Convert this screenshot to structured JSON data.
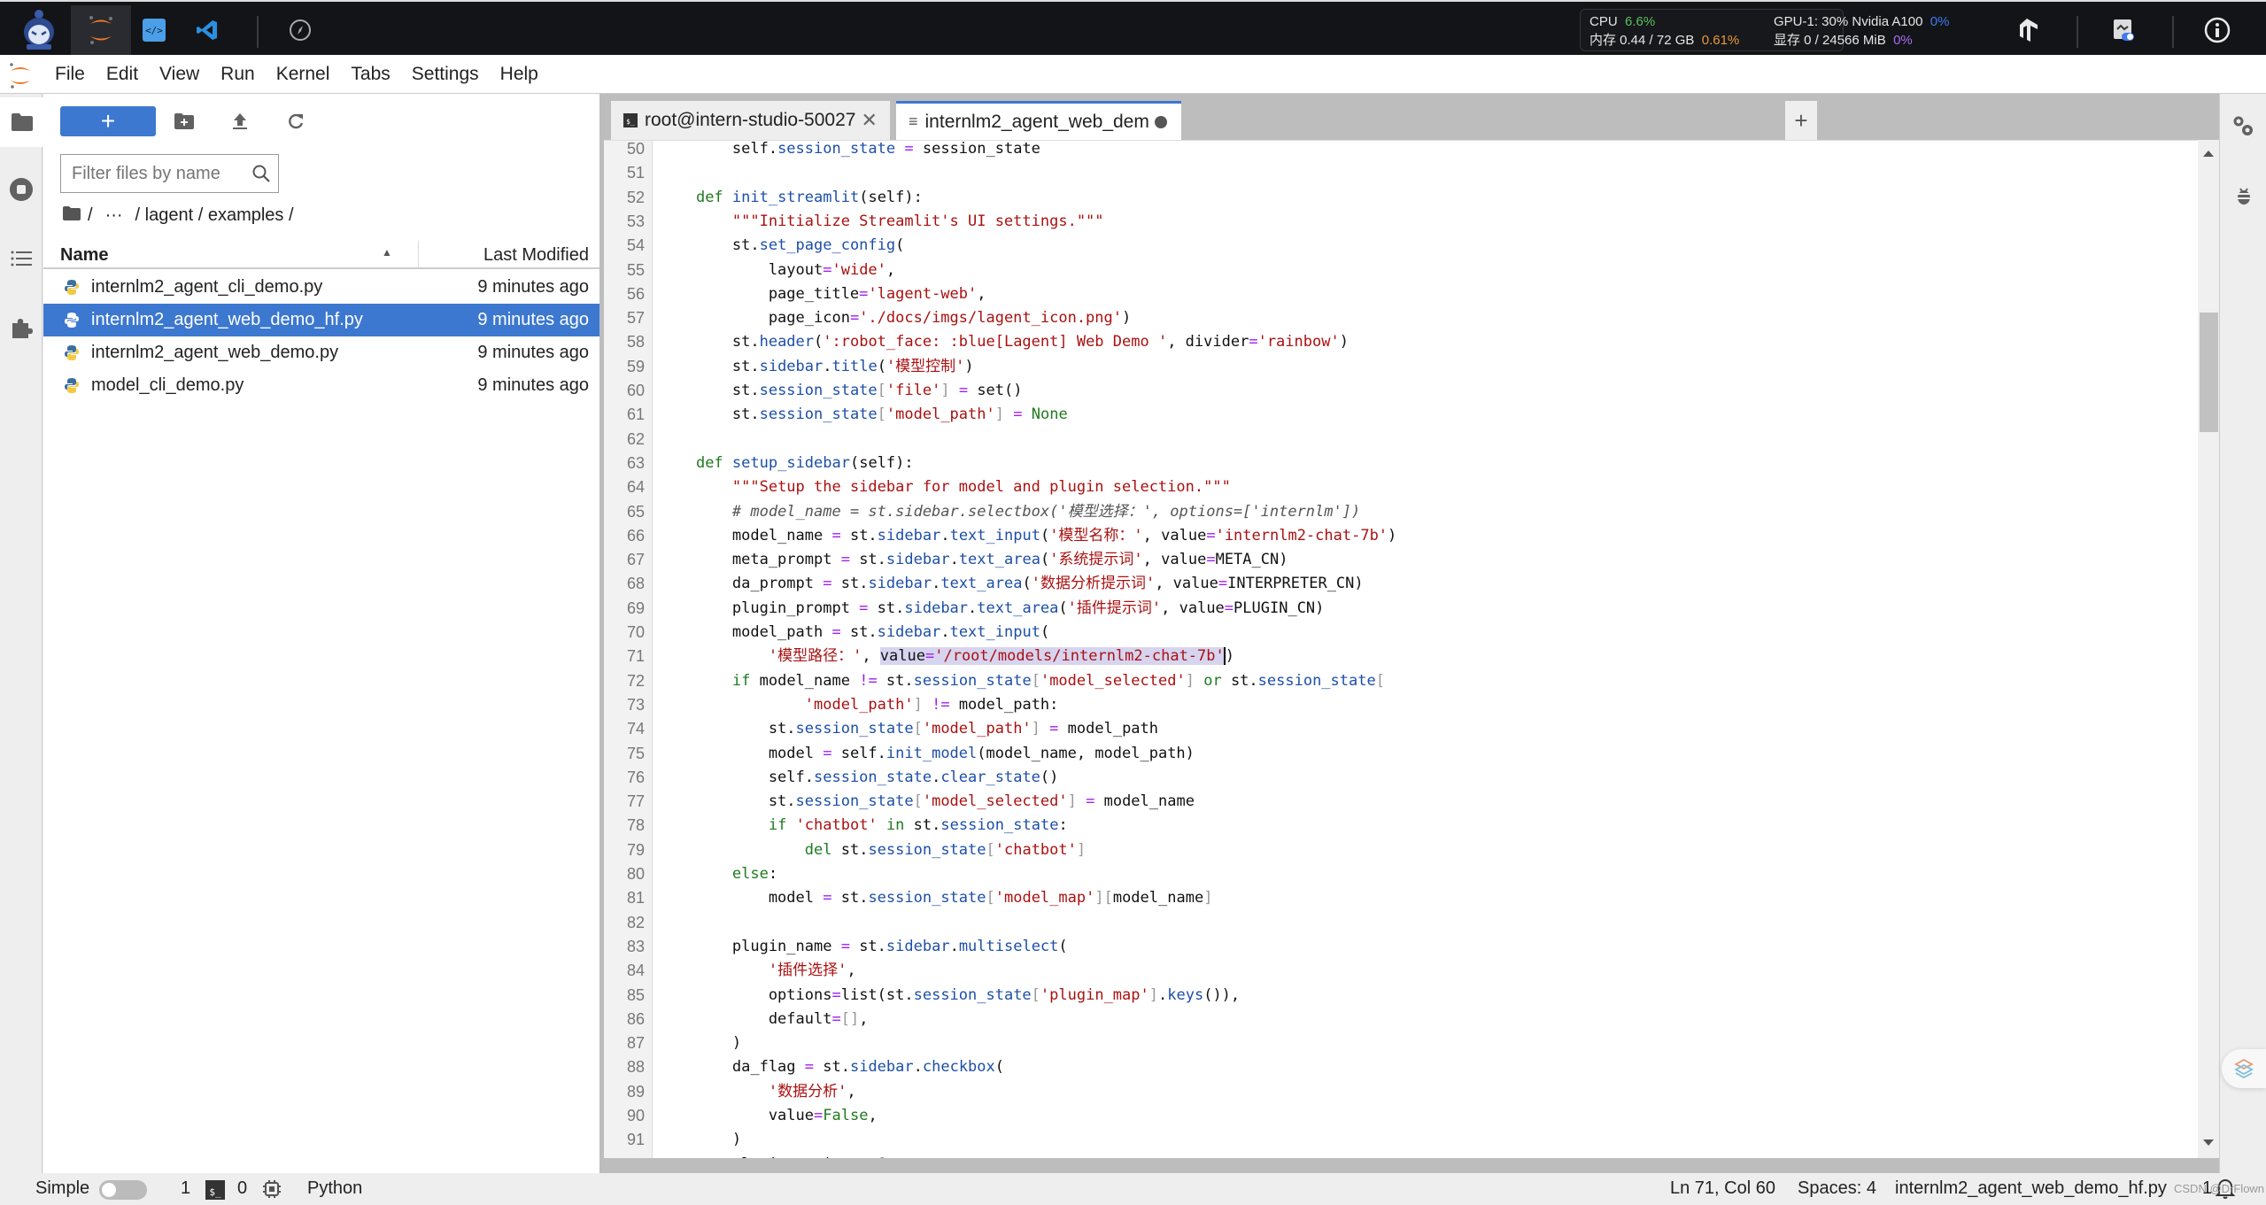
{
  "topbar": {
    "apps": [
      {
        "name": "jupyterlab",
        "active": true
      },
      {
        "name": "code-server",
        "active": false
      },
      {
        "name": "vscode",
        "active": false
      },
      {
        "name": "compass",
        "active": false
      }
    ],
    "stats": {
      "cpu_label": "CPU",
      "cpu_value": "6.6%",
      "gpu_label": "GPU-1: 30% Nvidia A100",
      "gpu_value": "0%",
      "mem_label": "内存 0.44 / 72 GB",
      "mem_value": "0.61%",
      "vram_label": "显存 0 / 24566 MiB",
      "vram_value": "0%"
    },
    "colors": {
      "cpu": "#58c05e",
      "mem": "#e6993d",
      "gpu": "#3d7cf0",
      "vram": "#a76ef2"
    }
  },
  "menu": [
    "File",
    "Edit",
    "View",
    "Run",
    "Kernel",
    "Tabs",
    "Settings",
    "Help"
  ],
  "filebrowser": {
    "new_label": "+",
    "filter_placeholder": "Filter files by name",
    "breadcrumb": [
      "/",
      "···",
      "/ lagent / examples /"
    ],
    "col_name": "Name",
    "col_modified": "Last Modified",
    "files": [
      {
        "name": "internlm2_agent_cli_demo.py",
        "modified": "9 minutes ago",
        "selected": false
      },
      {
        "name": "internlm2_agent_web_demo_hf.py",
        "modified": "9 minutes ago",
        "selected": true
      },
      {
        "name": "internlm2_agent_web_demo.py",
        "modified": "9 minutes ago",
        "selected": false
      },
      {
        "name": "model_cli_demo.py",
        "modified": "9 minutes ago",
        "selected": false
      }
    ]
  },
  "tabs": [
    {
      "label": "root@intern-studio-50027",
      "type": "terminal",
      "active": false
    },
    {
      "label": "internlm2_agent_web_dem",
      "type": "file",
      "active": true,
      "modified": true
    }
  ],
  "editor": {
    "first_line": 50,
    "lines": [
      [
        [
          "",
          "        self."
        ],
        [
          "f",
          "session_state"
        ],
        [
          "",
          " "
        ],
        [
          "o",
          "="
        ],
        [
          "",
          " session_state"
        ]
      ],
      [],
      [
        [
          "",
          "    "
        ],
        [
          "k",
          "def"
        ],
        [
          "",
          " "
        ],
        [
          "f",
          "init_streamlit"
        ],
        [
          "",
          "(self):"
        ]
      ],
      [
        [
          "",
          "        "
        ],
        [
          "s",
          "\"\"\"Initialize Streamlit's UI settings.\"\"\""
        ]
      ],
      [
        [
          "",
          "        st."
        ],
        [
          "f",
          "set_page_config"
        ],
        [
          "",
          "("
        ]
      ],
      [
        [
          "",
          "            layout"
        ],
        [
          "o",
          "="
        ],
        [
          "s",
          "'wide'"
        ],
        [
          "",
          ","
        ]
      ],
      [
        [
          "",
          "            page_title"
        ],
        [
          "o",
          "="
        ],
        [
          "s",
          "'lagent-web'"
        ],
        [
          "",
          ","
        ]
      ],
      [
        [
          "",
          "            page_icon"
        ],
        [
          "o",
          "="
        ],
        [
          "s",
          "'./docs/imgs/lagent_icon.png'"
        ],
        [
          "",
          ")"
        ]
      ],
      [
        [
          "",
          "        st."
        ],
        [
          "f",
          "header"
        ],
        [
          "",
          "("
        ],
        [
          "s",
          "':robot_face: :blue[Lagent] Web Demo '"
        ],
        [
          "",
          ", divider"
        ],
        [
          "o",
          "="
        ],
        [
          "s",
          "'rainbow'"
        ],
        [
          "",
          ")"
        ]
      ],
      [
        [
          "",
          "        st."
        ],
        [
          "f",
          "sidebar"
        ],
        [
          "",
          "."
        ],
        [
          "f",
          "title"
        ],
        [
          "",
          "("
        ],
        [
          "s",
          "'模型控制'"
        ],
        [
          "",
          ")"
        ]
      ],
      [
        [
          "",
          "        st."
        ],
        [
          "f",
          "session_state"
        ],
        [
          "br",
          "["
        ],
        [
          "s",
          "'file'"
        ],
        [
          "br",
          "]"
        ],
        [
          "",
          " "
        ],
        [
          "o",
          "="
        ],
        [
          "",
          " set()"
        ]
      ],
      [
        [
          "",
          "        st."
        ],
        [
          "f",
          "session_state"
        ],
        [
          "br",
          "["
        ],
        [
          "s",
          "'model_path'"
        ],
        [
          "br",
          "]"
        ],
        [
          "",
          " "
        ],
        [
          "o",
          "="
        ],
        [
          "",
          " "
        ],
        [
          "k",
          "None"
        ]
      ],
      [],
      [
        [
          "",
          "    "
        ],
        [
          "k",
          "def"
        ],
        [
          "",
          " "
        ],
        [
          "f",
          "setup_sidebar"
        ],
        [
          "",
          "(self):"
        ]
      ],
      [
        [
          "",
          "        "
        ],
        [
          "s",
          "\"\"\"Setup the sidebar for model and plugin selection.\"\"\""
        ]
      ],
      [
        [
          "",
          "        "
        ],
        [
          "c",
          "# model_name = st.sidebar.selectbox('模型选择：', options=['internlm'])"
        ]
      ],
      [
        [
          "",
          "        model_name "
        ],
        [
          "o",
          "="
        ],
        [
          "",
          " st."
        ],
        [
          "f",
          "sidebar"
        ],
        [
          "",
          "."
        ],
        [
          "f",
          "text_input"
        ],
        [
          "",
          "("
        ],
        [
          "s",
          "'模型名称：'"
        ],
        [
          "",
          ", value"
        ],
        [
          "o",
          "="
        ],
        [
          "s",
          "'internlm2-chat-7b'"
        ],
        [
          "",
          ")"
        ]
      ],
      [
        [
          "",
          "        meta_prompt "
        ],
        [
          "o",
          "="
        ],
        [
          "",
          " st."
        ],
        [
          "f",
          "sidebar"
        ],
        [
          "",
          "."
        ],
        [
          "f",
          "text_area"
        ],
        [
          "",
          "("
        ],
        [
          "s",
          "'系统提示词'"
        ],
        [
          "",
          ", value"
        ],
        [
          "o",
          "="
        ],
        [
          "",
          "META_CN)"
        ]
      ],
      [
        [
          "",
          "        da_prompt "
        ],
        [
          "o",
          "="
        ],
        [
          "",
          " st."
        ],
        [
          "f",
          "sidebar"
        ],
        [
          "",
          "."
        ],
        [
          "f",
          "text_area"
        ],
        [
          "",
          "("
        ],
        [
          "s",
          "'数据分析提示词'"
        ],
        [
          "",
          ", value"
        ],
        [
          "o",
          "="
        ],
        [
          "",
          "INTERPRETER_CN)"
        ]
      ],
      [
        [
          "",
          "        plugin_prompt "
        ],
        [
          "o",
          "="
        ],
        [
          "",
          " st."
        ],
        [
          "f",
          "sidebar"
        ],
        [
          "",
          "."
        ],
        [
          "f",
          "text_area"
        ],
        [
          "",
          "("
        ],
        [
          "s",
          "'插件提示词'"
        ],
        [
          "",
          ", value"
        ],
        [
          "o",
          "="
        ],
        [
          "",
          "PLUGIN_CN)"
        ]
      ],
      [
        [
          "",
          "        model_path "
        ],
        [
          "o",
          "="
        ],
        [
          "",
          " st."
        ],
        [
          "f",
          "sidebar"
        ],
        [
          "",
          "."
        ],
        [
          "f",
          "text_input"
        ],
        [
          "",
          "("
        ]
      ],
      [
        [
          "",
          "            "
        ],
        [
          "s",
          "'模型路径：'"
        ],
        [
          "",
          ", "
        ],
        [
          "hl",
          "value"
        ],
        [
          "hlo",
          "="
        ],
        [
          "hls",
          "'/root/models/internlm2-chat-7b'"
        ],
        [
          "cursor",
          ""
        ],
        [
          "",
          ")"
        ]
      ],
      [
        [
          "",
          "        "
        ],
        [
          "k",
          "if"
        ],
        [
          "",
          " model_name "
        ],
        [
          "o",
          "!="
        ],
        [
          "",
          " st."
        ],
        [
          "f",
          "session_state"
        ],
        [
          "br",
          "["
        ],
        [
          "s",
          "'model_selected'"
        ],
        [
          "br",
          "]"
        ],
        [
          "",
          " "
        ],
        [
          "k",
          "or"
        ],
        [
          "",
          " st."
        ],
        [
          "f",
          "session_state"
        ],
        [
          "br",
          "["
        ]
      ],
      [
        [
          "",
          "                "
        ],
        [
          "s",
          "'model_path'"
        ],
        [
          "br",
          "]"
        ],
        [
          "",
          " "
        ],
        [
          "o",
          "!="
        ],
        [
          "",
          " model_path:"
        ]
      ],
      [
        [
          "",
          "            st."
        ],
        [
          "f",
          "session_state"
        ],
        [
          "br",
          "["
        ],
        [
          "s",
          "'model_path'"
        ],
        [
          "br",
          "]"
        ],
        [
          "",
          " "
        ],
        [
          "o",
          "="
        ],
        [
          "",
          " model_path"
        ]
      ],
      [
        [
          "",
          "            model "
        ],
        [
          "o",
          "="
        ],
        [
          "",
          " self."
        ],
        [
          "f",
          "init_model"
        ],
        [
          "",
          "(model_name, model_path)"
        ]
      ],
      [
        [
          "",
          "            self."
        ],
        [
          "f",
          "session_state"
        ],
        [
          "",
          "."
        ],
        [
          "f",
          "clear_state"
        ],
        [
          "",
          "()"
        ]
      ],
      [
        [
          "",
          "            st."
        ],
        [
          "f",
          "session_state"
        ],
        [
          "br",
          "["
        ],
        [
          "s",
          "'model_selected'"
        ],
        [
          "br",
          "]"
        ],
        [
          "",
          " "
        ],
        [
          "o",
          "="
        ],
        [
          "",
          " model_name"
        ]
      ],
      [
        [
          "",
          "            "
        ],
        [
          "k",
          "if"
        ],
        [
          "",
          " "
        ],
        [
          "s",
          "'chatbot'"
        ],
        [
          "",
          " "
        ],
        [
          "k",
          "in"
        ],
        [
          "",
          " st."
        ],
        [
          "f",
          "session_state"
        ],
        [
          "",
          ":"
        ]
      ],
      [
        [
          "",
          "                "
        ],
        [
          "k",
          "del"
        ],
        [
          "",
          " st."
        ],
        [
          "f",
          "session_state"
        ],
        [
          "br",
          "["
        ],
        [
          "s",
          "'chatbot'"
        ],
        [
          "br",
          "]"
        ]
      ],
      [
        [
          "",
          "        "
        ],
        [
          "k",
          "else"
        ],
        [
          "",
          ":"
        ]
      ],
      [
        [
          "",
          "            model "
        ],
        [
          "o",
          "="
        ],
        [
          "",
          " st."
        ],
        [
          "f",
          "session_state"
        ],
        [
          "br",
          "["
        ],
        [
          "s",
          "'model_map'"
        ],
        [
          "br",
          "]["
        ],
        [
          "",
          "model_name"
        ],
        [
          "br",
          "]"
        ]
      ],
      [],
      [
        [
          "",
          "        plugin_name "
        ],
        [
          "o",
          "="
        ],
        [
          "",
          " st."
        ],
        [
          "f",
          "sidebar"
        ],
        [
          "",
          "."
        ],
        [
          "f",
          "multiselect"
        ],
        [
          "",
          "("
        ]
      ],
      [
        [
          "",
          "            "
        ],
        [
          "s",
          "'插件选择'"
        ],
        [
          "",
          ","
        ]
      ],
      [
        [
          "",
          "            options"
        ],
        [
          "o",
          "="
        ],
        [
          "",
          "list(st."
        ],
        [
          "f",
          "session_state"
        ],
        [
          "br",
          "["
        ],
        [
          "s",
          "'plugin_map'"
        ],
        [
          "br",
          "]"
        ],
        [
          "",
          "."
        ],
        [
          "f",
          "keys"
        ],
        [
          "",
          "()),"
        ]
      ],
      [
        [
          "",
          "            default"
        ],
        [
          "o",
          "="
        ],
        [
          "br",
          "[]"
        ],
        [
          "",
          ","
        ]
      ],
      [
        [
          "",
          "        )"
        ]
      ],
      [
        [
          "",
          "        da_flag "
        ],
        [
          "o",
          "="
        ],
        [
          "",
          " st."
        ],
        [
          "f",
          "sidebar"
        ],
        [
          "",
          "."
        ],
        [
          "f",
          "checkbox"
        ],
        [
          "",
          "("
        ]
      ],
      [
        [
          "",
          "            "
        ],
        [
          "s",
          "'数据分析'"
        ],
        [
          "",
          ","
        ]
      ],
      [
        [
          "",
          "            value"
        ],
        [
          "o",
          "="
        ],
        [
          "k",
          "False"
        ],
        [
          "",
          ","
        ]
      ],
      [
        [
          "",
          "        )"
        ]
      ],
      [
        [
          "",
          "        plugin_action "
        ],
        [
          "o",
          "="
        ],
        [
          "",
          " "
        ],
        [
          "br",
          "["
        ]
      ]
    ]
  },
  "statusbar": {
    "mode_label": "Simple",
    "mode_enabled": false,
    "terminals_count": "1",
    "kernels_count": "0",
    "kernel_name": "Python",
    "cursor_pos": "Ln 71, Col 60",
    "indent": "Spaces: 4",
    "file_name": "internlm2_agent_web_demo_hf.py",
    "notifications": "1",
    "watermark": "CSDN @DrFlown"
  }
}
